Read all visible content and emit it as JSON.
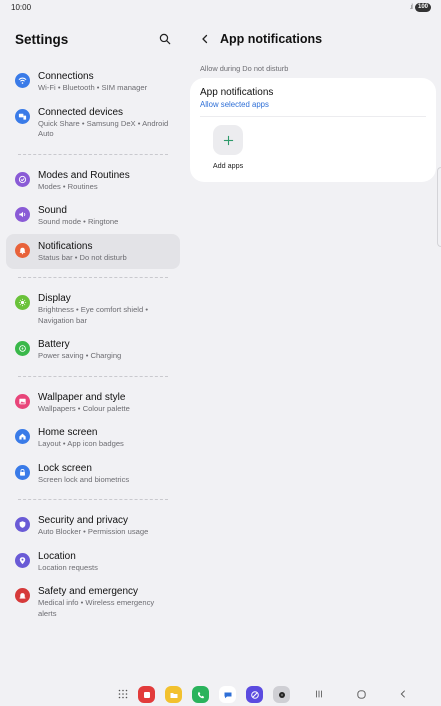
{
  "status_bar": {
    "time": "10:00",
    "battery": "100"
  },
  "left": {
    "title": "Settings",
    "items": [
      {
        "label": "Connections",
        "sub": "Wi-Fi  •  Bluetooth  •  SIM manager",
        "icon": "wifi-icon",
        "color": "#3a7be8"
      },
      {
        "label": "Connected devices",
        "sub": "Quick Share  •  Samsung DeX  •  Android Auto",
        "icon": "devices-icon",
        "color": "#3a7be8"
      },
      {
        "label": "Modes and Routines",
        "sub": "Modes  •  Routines",
        "icon": "check-circle-icon",
        "color": "#8a5bd6"
      },
      {
        "label": "Sound",
        "sub": "Sound mode  •  Ringtone",
        "icon": "speaker-icon",
        "color": "#8a5bd6"
      },
      {
        "label": "Notifications",
        "sub": "Status bar  •  Do not disturb",
        "icon": "bell-icon",
        "color": "#e8623a"
      },
      {
        "label": "Display",
        "sub": "Brightness  •  Eye comfort shield  •  Navigation bar",
        "icon": "sun-icon",
        "color": "#6ac23a"
      },
      {
        "label": "Battery",
        "sub": "Power saving  •  Charging",
        "icon": "battery-icon",
        "color": "#3ab84a"
      },
      {
        "label": "Wallpaper and style",
        "sub": "Wallpapers  •  Colour palette",
        "icon": "image-icon",
        "color": "#e8457a"
      },
      {
        "label": "Home screen",
        "sub": "Layout  •  App icon badges",
        "icon": "home-icon",
        "color": "#3a7be8"
      },
      {
        "label": "Lock screen",
        "sub": "Screen lock and biometrics",
        "icon": "lock-icon",
        "color": "#3a7be8"
      },
      {
        "label": "Security and privacy",
        "sub": "Auto Blocker  •  Permission usage",
        "icon": "shield-icon",
        "color": "#6a5bd6"
      },
      {
        "label": "Location",
        "sub": "Location requests",
        "icon": "location-pin-icon",
        "color": "#6a5bd6"
      },
      {
        "label": "Safety and emergency",
        "sub": "Medical info  •  Wireless emergency alerts",
        "icon": "emergency-icon",
        "color": "#d63a3a"
      }
    ]
  },
  "right": {
    "title": "App notifications",
    "section_label": "Allow during Do not disturb",
    "card_title": "App notifications",
    "card_link": "Allow selected apps",
    "add_label": "Add apps"
  }
}
